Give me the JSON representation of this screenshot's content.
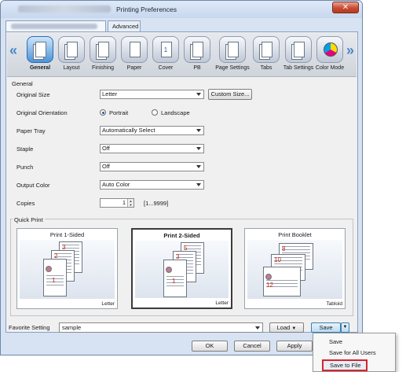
{
  "window": {
    "title": "Printing Preferences",
    "close_glyph": "✕"
  },
  "tabs": [
    {
      "label": ""
    },
    {
      "label": "Advanced"
    }
  ],
  "nav": {
    "left": "«",
    "right": "»"
  },
  "toolbar": {
    "items": [
      {
        "label": "General",
        "icon": "general-icon",
        "active": true
      },
      {
        "label": "Layout",
        "icon": "layout-icon"
      },
      {
        "label": "Finishing",
        "icon": "finishing-icon"
      },
      {
        "label": "Paper",
        "icon": "paper-icon"
      },
      {
        "label": "Cover",
        "icon": "cover-icon"
      },
      {
        "label": "PB",
        "icon": "perfect-binding-icon"
      },
      {
        "label": "Page Settings",
        "icon": "page-settings-icon"
      },
      {
        "label": "Tabs",
        "icon": "tabs-icon"
      },
      {
        "label": "Tab Settings",
        "icon": "tab-settings-icon"
      },
      {
        "label": "Color Mode",
        "icon": "color-mode-icon"
      }
    ]
  },
  "general": {
    "title": "General",
    "original_size": {
      "label": "Original Size",
      "value": "Letter",
      "button": "Custom Size..."
    },
    "orientation": {
      "label": "Original Orientation",
      "portrait": "Portrait",
      "landscape": "Landscape",
      "selected": "Portrait"
    },
    "paper_tray": {
      "label": "Paper Tray",
      "value": "Automatically Select"
    },
    "staple": {
      "label": "Staple",
      "value": "Off"
    },
    "punch": {
      "label": "Punch",
      "value": "Off"
    },
    "output_color": {
      "label": "Output Color",
      "value": "Auto Color"
    },
    "copies": {
      "label": "Copies",
      "value": "1",
      "range": "[1...9999]",
      "up": "▲",
      "down": "▼"
    }
  },
  "quick_print": {
    "title": "Quick Print",
    "cards": [
      {
        "title": "Print 1-Sided",
        "size": "Letter",
        "page_numbers": [
          "3",
          "2",
          "1"
        ]
      },
      {
        "title": "Print 2-Sided",
        "size": "Letter",
        "page_numbers": [
          "5",
          "3",
          "1"
        ],
        "selected": true
      },
      {
        "title": "Print Booklet",
        "size": "Tabloid",
        "page_numbers": [
          "8",
          "10",
          "12"
        ]
      }
    ]
  },
  "favorite": {
    "label": "Favorite Setting",
    "value": "sample",
    "load": "Load",
    "save": "Save"
  },
  "buttons": {
    "ok": "OK",
    "cancel": "Cancel",
    "apply": "Apply"
  },
  "save_menu": {
    "items": [
      "Save",
      "Save for All Users",
      "Save to File"
    ],
    "highlighted": "Save to File"
  }
}
